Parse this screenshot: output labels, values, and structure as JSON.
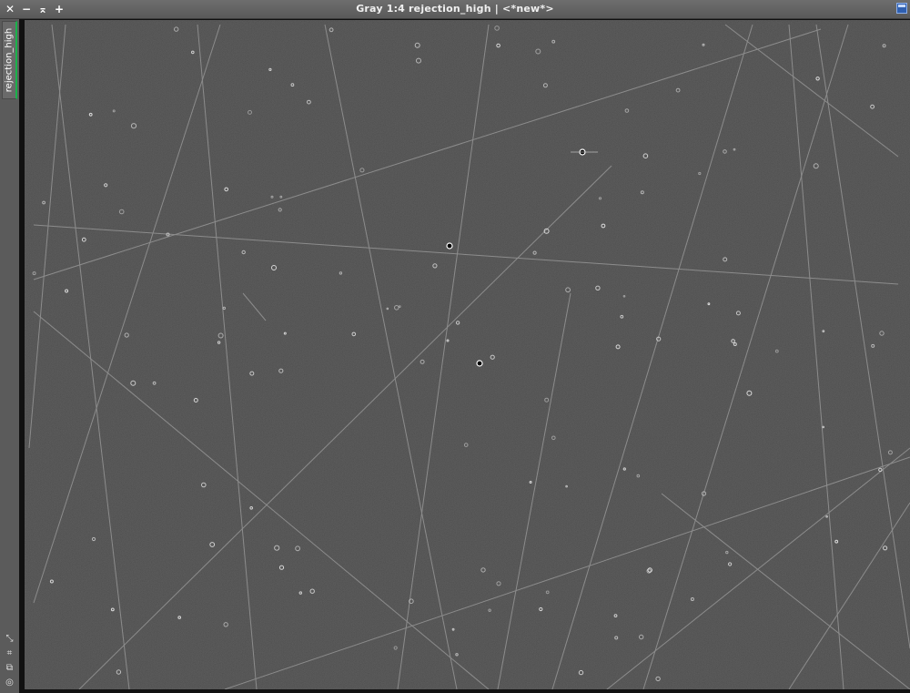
{
  "window": {
    "title": "Gray 1:4 rejection_high | <*new*>",
    "controls": {
      "close_glyph": "✕",
      "minimize_glyph": "−",
      "shade_glyph": "⌅",
      "maximize_glyph": "+"
    },
    "accent_color": "#19b34a"
  },
  "sidebar": {
    "tabs": [
      {
        "label": "rejection_high",
        "active": true
      }
    ],
    "tool_icons": [
      {
        "name": "fit-view-icon",
        "glyph": "⤡"
      },
      {
        "name": "zoom-frame-icon",
        "glyph": "⌗"
      },
      {
        "name": "clone-view-icon",
        "glyph": "⧉"
      },
      {
        "name": "target-icon",
        "glyph": "◎"
      }
    ]
  },
  "image": {
    "name": "rejection_high",
    "mode": "Gray",
    "zoom": "1:4",
    "background_color": "#363636",
    "trail_color": "#9a9a9a"
  }
}
